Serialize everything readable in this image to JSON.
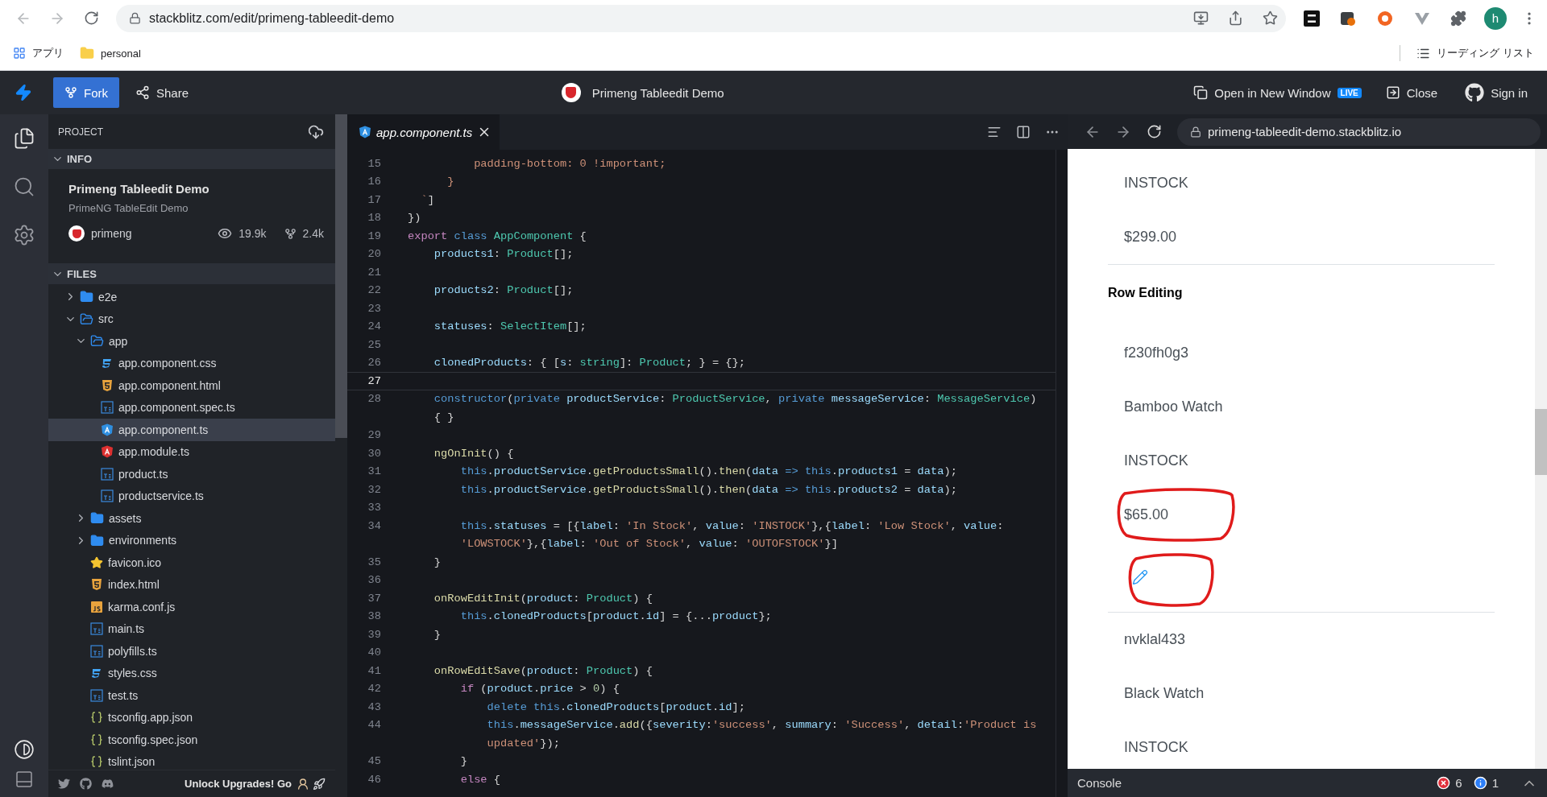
{
  "browser": {
    "url": "stackblitz.com/edit/primeng-tableedit-demo",
    "profile_initial": "h"
  },
  "bookmarks": {
    "items": [
      {
        "label": "アプリ",
        "kind": "apps"
      },
      {
        "label": "personal",
        "kind": "folder"
      }
    ],
    "reading_list": "リーディング リスト"
  },
  "header": {
    "fork": "Fork",
    "share": "Share",
    "title": "Primeng Tableedit Demo",
    "open_window": "Open in New Window",
    "live_badge": "LIVE",
    "close": "Close",
    "sign_in": "Sign in"
  },
  "sidebar": {
    "project_label": "PROJECT",
    "info": {
      "label": "INFO",
      "expanded": true,
      "title": "Primeng Tableedit Demo",
      "description": "PrimeNG TableEdit Demo",
      "owner": "primeng",
      "views": "19.9k",
      "forks": "2.4k"
    },
    "files": {
      "label": "FILES",
      "expanded": true,
      "tree": [
        {
          "name": "e2e",
          "kind": "folder",
          "expanded": false,
          "selected": false
        },
        {
          "name": "src",
          "kind": "folder",
          "expanded": true,
          "selected": false,
          "children": [
            {
              "name": "app",
              "kind": "folder",
              "expanded": true,
              "selected": false,
              "children": [
                {
                  "name": "app.component.css",
                  "kind": "css",
                  "selected": false
                },
                {
                  "name": "app.component.html",
                  "kind": "html",
                  "selected": false
                },
                {
                  "name": "app.component.spec.ts",
                  "kind": "ts",
                  "selected": false
                },
                {
                  "name": "app.component.ts",
                  "kind": "component",
                  "selected": true
                },
                {
                  "name": "app.module.ts",
                  "kind": "module",
                  "selected": false
                },
                {
                  "name": "product.ts",
                  "kind": "ts",
                  "selected": false
                },
                {
                  "name": "productservice.ts",
                  "kind": "ts",
                  "selected": false
                }
              ]
            },
            {
              "name": "assets",
              "kind": "folder",
              "expanded": false,
              "selected": false
            },
            {
              "name": "environments",
              "kind": "folder",
              "expanded": false,
              "selected": false
            },
            {
              "name": "favicon.ico",
              "kind": "star",
              "selected": false
            },
            {
              "name": "index.html",
              "kind": "html",
              "selected": false
            },
            {
              "name": "karma.conf.js",
              "kind": "js",
              "selected": false
            },
            {
              "name": "main.ts",
              "kind": "ts",
              "selected": false
            },
            {
              "name": "polyfills.ts",
              "kind": "ts",
              "selected": false
            },
            {
              "name": "styles.css",
              "kind": "css",
              "selected": false
            },
            {
              "name": "test.ts",
              "kind": "ts",
              "selected": false
            },
            {
              "name": "tsconfig.app.json",
              "kind": "json",
              "selected": false
            },
            {
              "name": "tsconfig.spec.json",
              "kind": "json",
              "selected": false
            },
            {
              "name": "tslint.json",
              "kind": "json",
              "selected": false
            }
          ]
        }
      ]
    },
    "footer": {
      "upgrade": "Unlock Upgrades! Go"
    }
  },
  "editor": {
    "tab": {
      "label": "app.component.ts",
      "selected": true
    },
    "lines": [
      {
        "number": "15",
        "current": false,
        "tokens": [
          {
            "kind": "str",
            "text": "          padding-bottom: 0 !important;"
          }
        ]
      },
      {
        "number": "16",
        "current": false,
        "tokens": [
          {
            "kind": "str",
            "text": "      }"
          }
        ]
      },
      {
        "number": "17",
        "current": false,
        "tokens": [
          {
            "kind": "str",
            "text": "  `"
          },
          {
            "kind": "plain",
            "text": "]"
          }
        ]
      },
      {
        "number": "18",
        "current": false,
        "tokens": [
          {
            "kind": "plain",
            "text": "})"
          }
        ]
      },
      {
        "number": "19",
        "current": false,
        "tokens": [
          {
            "kind": "kw",
            "text": "export"
          },
          {
            "kind": "kw2",
            "text": " class"
          },
          {
            "kind": "type",
            "text": " AppComponent"
          },
          {
            "kind": "plain",
            "text": " {"
          }
        ]
      },
      {
        "number": "20",
        "current": false,
        "tokens": [
          {
            "kind": "prop",
            "text": "    products1"
          },
          {
            "kind": "plain",
            "text": ": "
          },
          {
            "kind": "type",
            "text": "Product"
          },
          {
            "kind": "plain",
            "text": "[];"
          }
        ]
      },
      {
        "number": "21",
        "current": false
      },
      {
        "number": "22",
        "current": false,
        "tokens": [
          {
            "kind": "prop",
            "text": "    products2"
          },
          {
            "kind": "plain",
            "text": ": "
          },
          {
            "kind": "type",
            "text": "Product"
          },
          {
            "kind": "plain",
            "text": "[];"
          }
        ]
      },
      {
        "number": "23",
        "current": false
      },
      {
        "number": "24",
        "current": false,
        "tokens": [
          {
            "kind": "prop",
            "text": "    statuses"
          },
          {
            "kind": "plain",
            "text": ": "
          },
          {
            "kind": "type",
            "text": "SelectItem"
          },
          {
            "kind": "plain",
            "text": "[];"
          }
        ]
      },
      {
        "number": "25",
        "current": false
      },
      {
        "number": "26",
        "current": false,
        "tokens": [
          {
            "kind": "prop",
            "text": "    clonedProducts"
          },
          {
            "kind": "plain",
            "text": ": { ["
          },
          {
            "kind": "prop",
            "text": "s"
          },
          {
            "kind": "plain",
            "text": ": "
          },
          {
            "kind": "type",
            "text": "string"
          },
          {
            "kind": "plain",
            "text": "]: "
          },
          {
            "kind": "type",
            "text": "Product"
          },
          {
            "kind": "plain",
            "text": "; } = {};"
          }
        ]
      },
      {
        "number": "27",
        "current": true
      },
      {
        "number": "28",
        "current": false,
        "tokens": [
          {
            "kind": "kw2",
            "text": "    constructor"
          },
          {
            "kind": "plain",
            "text": "("
          },
          {
            "kind": "kw2",
            "text": "private"
          },
          {
            "kind": "prop",
            "text": " productService"
          },
          {
            "kind": "plain",
            "text": ": "
          },
          {
            "kind": "type",
            "text": "ProductService"
          },
          {
            "kind": "plain",
            "text": ", "
          },
          {
            "kind": "kw2",
            "text": "private"
          },
          {
            "kind": "prop",
            "text": " messageService"
          },
          {
            "kind": "plain",
            "text": ": "
          },
          {
            "kind": "type",
            "text": "MessageService"
          },
          {
            "kind": "plain",
            "text": ")"
          }
        ]
      },
      {
        "tokens": [
          {
            "kind": "plain",
            "text": "    { }"
          }
        ]
      },
      {
        "number": "29",
        "current": false
      },
      {
        "number": "30",
        "current": false,
        "tokens": [
          {
            "kind": "fn",
            "text": "    ngOnInit"
          },
          {
            "kind": "plain",
            "text": "() {"
          }
        ]
      },
      {
        "number": "31",
        "current": false,
        "tokens": [
          {
            "kind": "kw2",
            "text": "        this"
          },
          {
            "kind": "plain",
            "text": "."
          },
          {
            "kind": "prop",
            "text": "productService"
          },
          {
            "kind": "plain",
            "text": "."
          },
          {
            "kind": "fn",
            "text": "getProductsSmall"
          },
          {
            "kind": "plain",
            "text": "()."
          },
          {
            "kind": "fn",
            "text": "then"
          },
          {
            "kind": "plain",
            "text": "("
          },
          {
            "kind": "prop",
            "text": "data"
          },
          {
            "kind": "kw2",
            "text": " =>"
          },
          {
            "kind": "kw2",
            "text": " this"
          },
          {
            "kind": "plain",
            "text": "."
          },
          {
            "kind": "prop",
            "text": "products1"
          },
          {
            "kind": "plain",
            "text": " = "
          },
          {
            "kind": "prop",
            "text": "data"
          },
          {
            "kind": "plain",
            "text": ");"
          }
        ]
      },
      {
        "number": "32",
        "current": false,
        "tokens": [
          {
            "kind": "kw2",
            "text": "        this"
          },
          {
            "kind": "plain",
            "text": "."
          },
          {
            "kind": "prop",
            "text": "productService"
          },
          {
            "kind": "plain",
            "text": "."
          },
          {
            "kind": "fn",
            "text": "getProductsSmall"
          },
          {
            "kind": "plain",
            "text": "()."
          },
          {
            "kind": "fn",
            "text": "then"
          },
          {
            "kind": "plain",
            "text": "("
          },
          {
            "kind": "prop",
            "text": "data"
          },
          {
            "kind": "kw2",
            "text": " =>"
          },
          {
            "kind": "kw2",
            "text": " this"
          },
          {
            "kind": "plain",
            "text": "."
          },
          {
            "kind": "prop",
            "text": "products2"
          },
          {
            "kind": "plain",
            "text": " = "
          },
          {
            "kind": "prop",
            "text": "data"
          },
          {
            "kind": "plain",
            "text": ");"
          }
        ]
      },
      {
        "number": "33",
        "current": false
      },
      {
        "number": "34",
        "current": false,
        "tokens": [
          {
            "kind": "kw2",
            "text": "        this"
          },
          {
            "kind": "plain",
            "text": "."
          },
          {
            "kind": "prop",
            "text": "statuses"
          },
          {
            "kind": "plain",
            "text": " = [{"
          },
          {
            "kind": "prop",
            "text": "label"
          },
          {
            "kind": "plain",
            "text": ": "
          },
          {
            "kind": "str",
            "text": "'In Stock'"
          },
          {
            "kind": "plain",
            "text": ", "
          },
          {
            "kind": "prop",
            "text": "value"
          },
          {
            "kind": "plain",
            "text": ": "
          },
          {
            "kind": "str",
            "text": "'INSTOCK'"
          },
          {
            "kind": "plain",
            "text": "},{"
          },
          {
            "kind": "prop",
            "text": "label"
          },
          {
            "kind": "plain",
            "text": ": "
          },
          {
            "kind": "str",
            "text": "'Low Stock'"
          },
          {
            "kind": "plain",
            "text": ", "
          },
          {
            "kind": "prop",
            "text": "value"
          },
          {
            "kind": "plain",
            "text": ":"
          }
        ]
      },
      {
        "tokens": [
          {
            "kind": "str",
            "text": "        'LOWSTOCK'"
          },
          {
            "kind": "plain",
            "text": "},{"
          },
          {
            "kind": "prop",
            "text": "label"
          },
          {
            "kind": "plain",
            "text": ": "
          },
          {
            "kind": "str",
            "text": "'Out of Stock'"
          },
          {
            "kind": "plain",
            "text": ", "
          },
          {
            "kind": "prop",
            "text": "value"
          },
          {
            "kind": "plain",
            "text": ": "
          },
          {
            "kind": "str",
            "text": "'OUTOFSTOCK'"
          },
          {
            "kind": "plain",
            "text": "}]"
          }
        ]
      },
      {
        "number": "35",
        "current": false,
        "tokens": [
          {
            "kind": "plain",
            "text": "    }"
          }
        ]
      },
      {
        "number": "36",
        "current": false
      },
      {
        "number": "37",
        "current": false,
        "tokens": [
          {
            "kind": "fn",
            "text": "    onRowEditInit"
          },
          {
            "kind": "plain",
            "text": "("
          },
          {
            "kind": "prop",
            "text": "product"
          },
          {
            "kind": "plain",
            "text": ": "
          },
          {
            "kind": "type",
            "text": "Product"
          },
          {
            "kind": "plain",
            "text": ") {"
          }
        ]
      },
      {
        "number": "38",
        "current": false,
        "tokens": [
          {
            "kind": "kw2",
            "text": "        this"
          },
          {
            "kind": "plain",
            "text": "."
          },
          {
            "kind": "prop",
            "text": "clonedProducts"
          },
          {
            "kind": "plain",
            "text": "["
          },
          {
            "kind": "prop",
            "text": "product"
          },
          {
            "kind": "plain",
            "text": "."
          },
          {
            "kind": "prop",
            "text": "id"
          },
          {
            "kind": "plain",
            "text": "] = {..."
          },
          {
            "kind": "prop",
            "text": "product"
          },
          {
            "kind": "plain",
            "text": "};"
          }
        ]
      },
      {
        "number": "39",
        "current": false,
        "tokens": [
          {
            "kind": "plain",
            "text": "    }"
          }
        ]
      },
      {
        "number": "40",
        "current": false
      },
      {
        "number": "41",
        "current": false,
        "tokens": [
          {
            "kind": "fn",
            "text": "    onRowEditSave"
          },
          {
            "kind": "plain",
            "text": "("
          },
          {
            "kind": "prop",
            "text": "product"
          },
          {
            "kind": "plain",
            "text": ": "
          },
          {
            "kind": "type",
            "text": "Product"
          },
          {
            "kind": "plain",
            "text": ") {"
          }
        ]
      },
      {
        "number": "42",
        "current": false,
        "tokens": [
          {
            "kind": "kw",
            "text": "        if"
          },
          {
            "kind": "plain",
            "text": " ("
          },
          {
            "kind": "prop",
            "text": "product"
          },
          {
            "kind": "plain",
            "text": "."
          },
          {
            "kind": "prop",
            "text": "price"
          },
          {
            "kind": "plain",
            "text": " > "
          },
          {
            "kind": "num",
            "text": "0"
          },
          {
            "kind": "plain",
            "text": ") {"
          }
        ]
      },
      {
        "number": "43",
        "current": false,
        "tokens": [
          {
            "kind": "kw2",
            "text": "            delete"
          },
          {
            "kind": "kw2",
            "text": " this"
          },
          {
            "kind": "plain",
            "text": "."
          },
          {
            "kind": "prop",
            "text": "clonedProducts"
          },
          {
            "kind": "plain",
            "text": "["
          },
          {
            "kind": "prop",
            "text": "product"
          },
          {
            "kind": "plain",
            "text": "."
          },
          {
            "kind": "prop",
            "text": "id"
          },
          {
            "kind": "plain",
            "text": "];"
          }
        ]
      },
      {
        "number": "44",
        "current": false,
        "tokens": [
          {
            "kind": "kw2",
            "text": "            this"
          },
          {
            "kind": "plain",
            "text": "."
          },
          {
            "kind": "prop",
            "text": "messageService"
          },
          {
            "kind": "plain",
            "text": "."
          },
          {
            "kind": "fn",
            "text": "add"
          },
          {
            "kind": "plain",
            "text": "({"
          },
          {
            "kind": "prop",
            "text": "severity"
          },
          {
            "kind": "plain",
            "text": ":"
          },
          {
            "kind": "str",
            "text": "'success'"
          },
          {
            "kind": "plain",
            "text": ", "
          },
          {
            "kind": "prop",
            "text": "summary"
          },
          {
            "kind": "plain",
            "text": ": "
          },
          {
            "kind": "str",
            "text": "'Success'"
          },
          {
            "kind": "plain",
            "text": ", "
          },
          {
            "kind": "prop",
            "text": "detail"
          },
          {
            "kind": "plain",
            "text": ":"
          },
          {
            "kind": "str",
            "text": "'Product is"
          }
        ]
      },
      {
        "tokens": [
          {
            "kind": "str",
            "text": "            updated'"
          },
          {
            "kind": "plain",
            "text": "});"
          }
        ]
      },
      {
        "number": "45",
        "current": false,
        "tokens": [
          {
            "kind": "plain",
            "text": "        }"
          }
        ]
      },
      {
        "number": "46",
        "current": false,
        "tokens": [
          {
            "kind": "kw",
            "text": "        else"
          },
          {
            "kind": "plain",
            "text": " {"
          }
        ]
      }
    ]
  },
  "preview": {
    "url": "primeng-tableedit-demo.stackblitz.io",
    "blocks": [
      {
        "kind": "row",
        "cells": [
          {
            "kind": "text",
            "text": "INSTOCK",
            "circled": false
          },
          {
            "kind": "text",
            "text": "$299.00",
            "circled": false
          }
        ]
      },
      {
        "kind": "heading",
        "text": "Row Editing"
      },
      {
        "kind": "row",
        "cells": [
          {
            "kind": "text",
            "text": "f230fh0g3",
            "circled": false
          },
          {
            "kind": "text",
            "text": "Bamboo Watch",
            "circled": false
          },
          {
            "kind": "text",
            "text": "INSTOCK",
            "circled": false
          },
          {
            "kind": "text",
            "text": "$65.00",
            "circled": true
          },
          {
            "kind": "edit",
            "circled": true
          }
        ]
      },
      {
        "kind": "row",
        "cells": [
          {
            "kind": "text",
            "text": "nvklal433",
            "circled": false
          },
          {
            "kind": "text",
            "text": "Black Watch",
            "circled": false
          },
          {
            "kind": "text",
            "text": "INSTOCK",
            "circled": false
          }
        ]
      }
    ]
  },
  "console": {
    "label": "Console",
    "errors": "6",
    "infos": "1"
  }
}
